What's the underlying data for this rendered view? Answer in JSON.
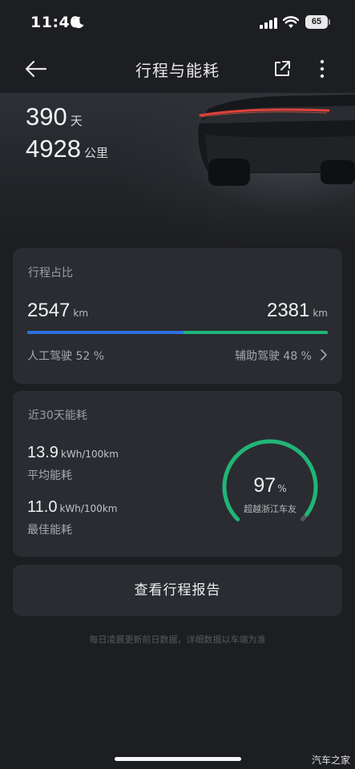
{
  "status_bar": {
    "time": "11:40",
    "battery": "65",
    "icons": [
      "moon-icon",
      "signal-icon",
      "wifi-icon",
      "battery-icon"
    ]
  },
  "nav": {
    "title": "行程与能耗",
    "icons": [
      "back-arrow-icon",
      "share-icon",
      "more-icon"
    ]
  },
  "hero": {
    "days_value": "390",
    "days_unit": "天",
    "km_value": "4928",
    "km_unit": "公里"
  },
  "trip_ratio": {
    "title": "行程占比",
    "manual_km": "2547",
    "assist_km": "2381",
    "unit": "km",
    "manual_label": "人工驾驶 52 %",
    "assist_label": "辅助驾驶 48 %",
    "manual_fraction": 0.52,
    "colors": {
      "manual": "#2f6fe0",
      "assist": "#20b577"
    }
  },
  "energy": {
    "title": "近30天能耗",
    "avg_value": "13.9",
    "avg_unit": "kWh/100km",
    "avg_label": "平均能耗",
    "best_value": "11.0",
    "best_unit": "kWh/100km",
    "best_label": "最佳能耗",
    "gauge_percent": "97",
    "gauge_unit": "%",
    "gauge_fraction": 0.97,
    "gauge_label": "超越浙江车友",
    "colors": {
      "gauge": "#20b577",
      "track": "#55575c"
    }
  },
  "report_button": "查看行程报告",
  "footnote": "每日凌晨更新前日数据，详细数据以车端为准",
  "watermark": "汽车之家"
}
